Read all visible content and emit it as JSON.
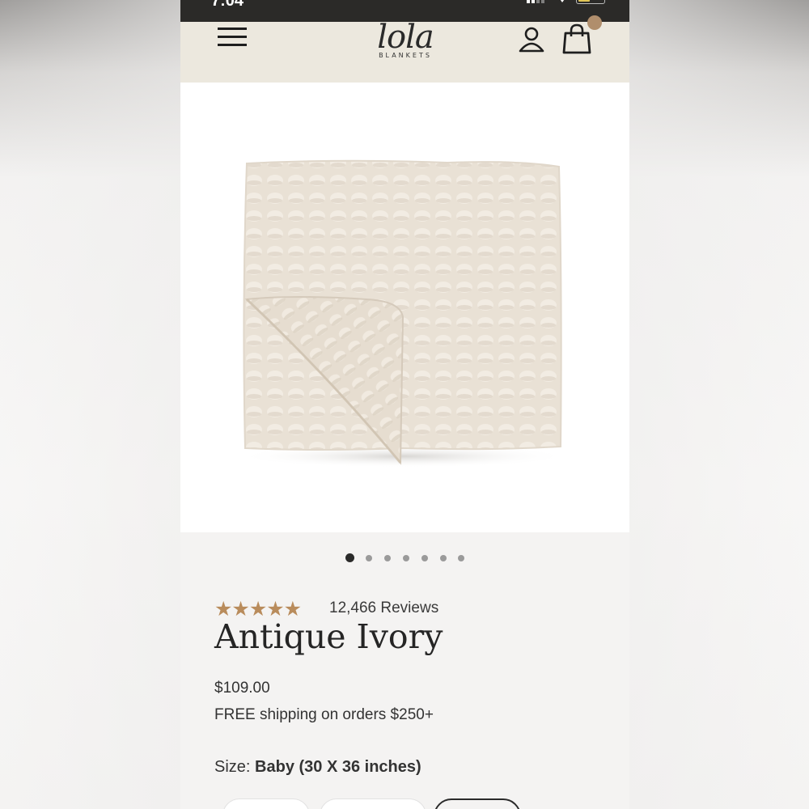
{
  "status_bar": {
    "time": "7:04"
  },
  "header": {
    "logo_text": "lola",
    "logo_sub": "BLANKETS",
    "menu_icon": "hamburger-menu-icon",
    "account_icon": "user-icon",
    "cart_icon": "shopping-bag-icon"
  },
  "gallery": {
    "total_images": 7,
    "active_index": 0
  },
  "product": {
    "stars": "★★★★★",
    "rating": 5,
    "reviews": "12,466 Reviews",
    "title": "Antique Ivory",
    "price": "$109.00",
    "shipping": "FREE shipping on orders $250+",
    "size_label": "Size:",
    "size_value": "Baby (30 X 36 inches)"
  },
  "colors": {
    "accent_star": "#b98c5c",
    "header_bg": "#ece8de",
    "cart_badge": "#b08e6c"
  }
}
